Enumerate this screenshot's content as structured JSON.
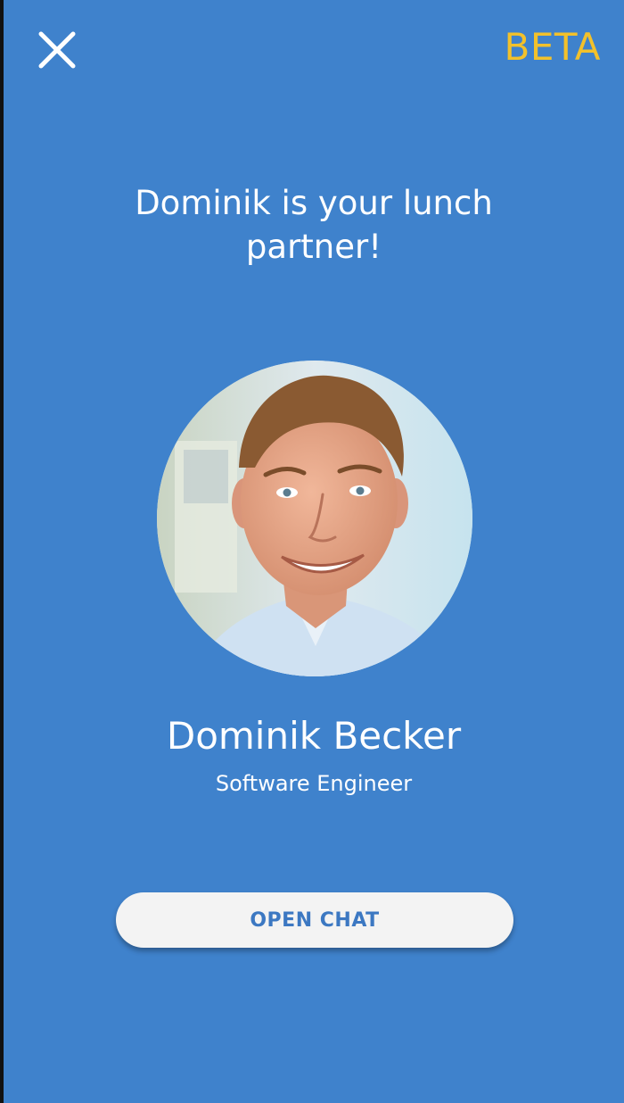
{
  "header": {
    "close_icon": "close-icon",
    "badge": "BETA"
  },
  "headline": "Dominik is your lunch partner!",
  "profile": {
    "name": "Dominik Becker",
    "role": "Software Engineer",
    "photo": "profile-photo"
  },
  "actions": {
    "open_chat_label": "OPEN CHAT"
  },
  "colors": {
    "background": "#3f82cc",
    "badge": "#f2c12b",
    "button_bg": "#f3f3f3",
    "button_text": "#3c78c2",
    "text": "#ffffff"
  }
}
